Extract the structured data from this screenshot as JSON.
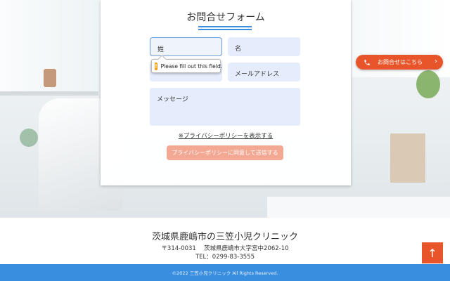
{
  "form": {
    "title": "お問合せフォーム",
    "last_name_placeholder": "姓",
    "first_name_placeholder": "名",
    "email_placeholder": "メールアドレス",
    "message_placeholder": "メッセージ",
    "validation_message": "Please fill out this field.",
    "privacy_link": "※プライバシーポリシーを表示する",
    "submit_label": "プライバシーポリシーに同意して送信する"
  },
  "contact_button": {
    "label": "お問合せはこちら",
    "icon": "phone-icon"
  },
  "clinic": {
    "name": "茨城県鹿嶋市の三笠小児クリニック",
    "address": "〒314-0031　 茨城県鹿嶋市大字宮中2062-10",
    "tel": "TEL：0299-83-3555"
  },
  "back_to_top_icon": "arrow-up-icon",
  "footer": {
    "copyright": "©2022 三笠小児クリニック All Rights Reserved."
  },
  "colors": {
    "accent_blue": "#3a8ee0",
    "accent_orange": "#e8552a",
    "field_bg": "#e5ecfb"
  }
}
